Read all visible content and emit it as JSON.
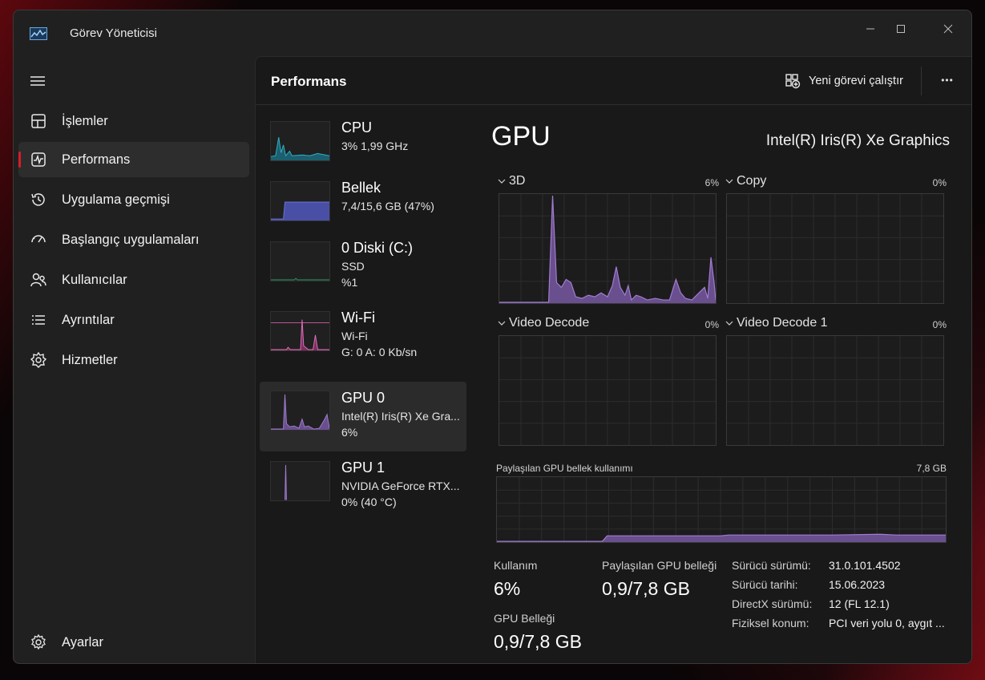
{
  "window": {
    "title": "Görev Yöneticisi"
  },
  "sidebar": {
    "items": [
      {
        "label": "İşlemler",
        "icon": "processes-icon"
      },
      {
        "label": "Performans",
        "icon": "performance-icon",
        "active": true
      },
      {
        "label": "Uygulama geçmişi",
        "icon": "history-icon"
      },
      {
        "label": "Başlangıç uygulamaları",
        "icon": "startup-icon"
      },
      {
        "label": "Kullanıcılar",
        "icon": "users-icon"
      },
      {
        "label": "Ayrıntılar",
        "icon": "details-icon"
      },
      {
        "label": "Hizmetler",
        "icon": "services-icon"
      }
    ],
    "settings_label": "Ayarlar"
  },
  "header": {
    "title": "Performans",
    "run_task_label": "Yeni görevi çalıştır",
    "more_label": "•••"
  },
  "devices": [
    {
      "name": "CPU",
      "sub1": "3%  1,99 GHz",
      "sub2": "",
      "color": "#2fb0c8"
    },
    {
      "name": "Bellek",
      "sub1": "7,4/15,6 GB (47%)",
      "sub2": "",
      "color": "#6b72d6"
    },
    {
      "name": "0 Diski (C:)",
      "sub1": "SSD",
      "sub2": "%1",
      "color": "#2f9d66"
    },
    {
      "name": "Wi-Fi",
      "sub1": "Wi-Fi",
      "sub2": "G: 0 A: 0 Kb/sn",
      "color": "#d45aa8"
    },
    {
      "name": "GPU 0",
      "sub1": "Intel(R) Iris(R) Xe Gra...",
      "sub2": "6%",
      "color": "#a07cd1",
      "active": true
    },
    {
      "name": "GPU 1",
      "sub1": "NVIDIA GeForce RTX...",
      "sub2": "0% (40 °C)",
      "color": "#a07cd1"
    }
  ],
  "detail": {
    "title": "GPU",
    "model": "Intel(R) Iris(R) Xe Graphics",
    "graphs": [
      {
        "label": "3D",
        "percent": "6%"
      },
      {
        "label": "Copy",
        "percent": "0%"
      },
      {
        "label": "Video Decode",
        "percent": "0%"
      },
      {
        "label": "Video Decode 1",
        "percent": "0%"
      }
    ],
    "shared_mem": {
      "label": "Paylaşılan GPU bellek kullanımı",
      "max": "7,8 GB"
    },
    "stats": {
      "usage_label": "Kullanım",
      "usage_value": "6%",
      "shared_label": "Paylaşılan GPU belleği",
      "shared_value": "0,9/7,8 GB",
      "gpu_mem_label": "GPU Belleği",
      "gpu_mem_value": "0,9/7,8 GB"
    },
    "info": [
      {
        "key": "Sürücü sürümü:",
        "value": "31.0.101.4502"
      },
      {
        "key": "Sürücü tarihi:",
        "value": "15.06.2023"
      },
      {
        "key": "DirectX sürümü:",
        "value": "12 (FL 12.1)"
      },
      {
        "key": "Fiziksel konum:",
        "value": "PCI veri yolu 0, aygıt ..."
      }
    ]
  },
  "colors": {
    "accent": "#d81b2c",
    "gpu_graph": "#a07cd1"
  }
}
